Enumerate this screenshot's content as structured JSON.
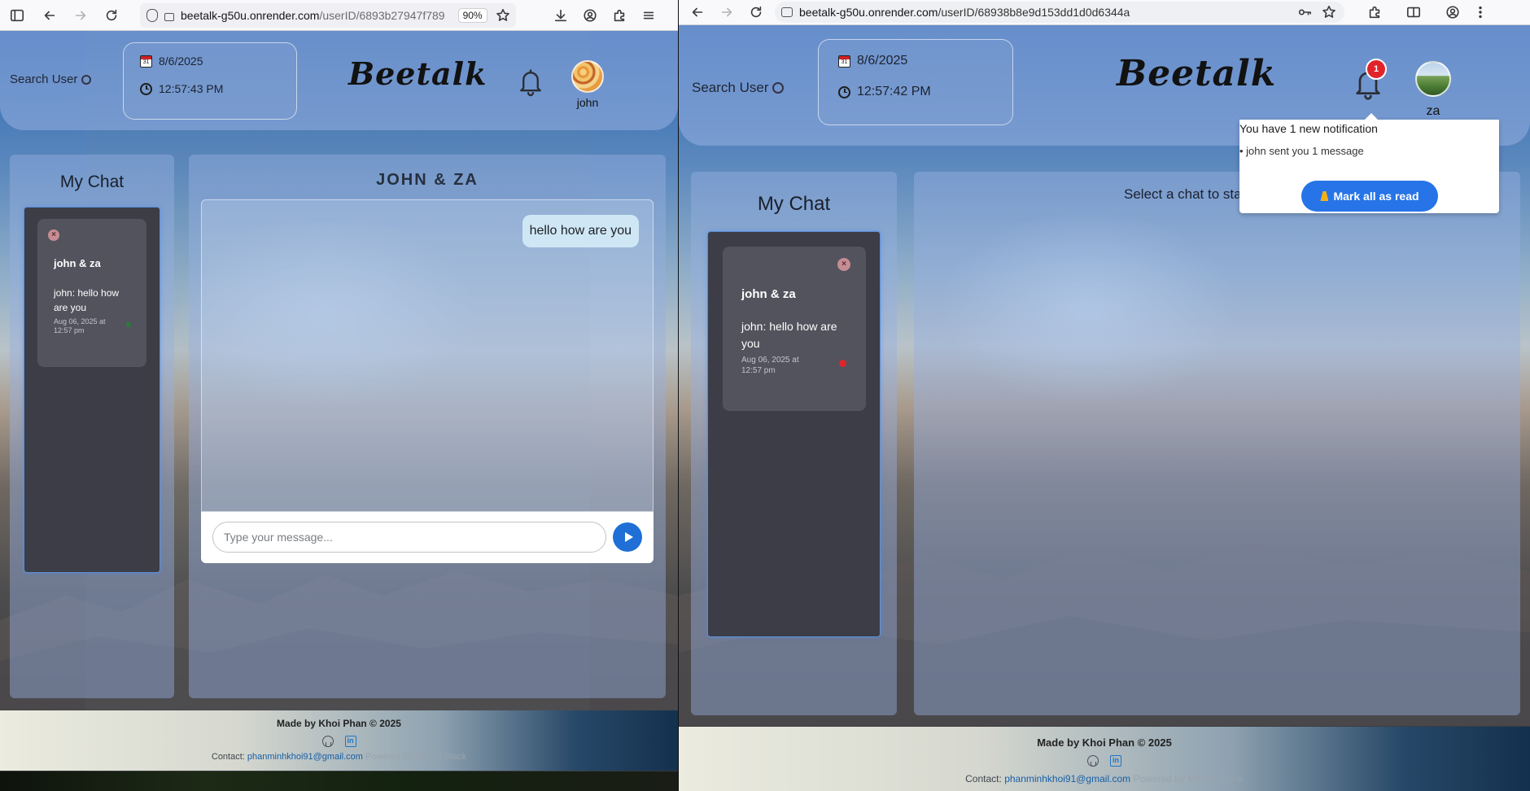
{
  "left": {
    "browser": {
      "url_host": "beetalk-g50u.onrender.com",
      "url_path": "/userID/6893b27947f789",
      "zoom": "90%"
    },
    "header": {
      "search_label": "Search User",
      "date": "8/6/2025",
      "time": "12:57:43 PM",
      "logo": "Beetalk",
      "username": "john"
    },
    "sidebar": {
      "title": "My Chat",
      "chats": [
        {
          "title": "john & za",
          "last_message": "john: hello how are you",
          "time": "Aug 06, 2025 at 12:57 pm"
        }
      ]
    },
    "chat": {
      "title": "JOHN & ZA",
      "messages": [
        {
          "text": "hello how are you",
          "own": true
        }
      ],
      "input_placeholder": "Type your message..."
    },
    "footer": {
      "made_by": "Made by Khoi Phan © 2025",
      "contact_label": "Contact:",
      "email": "phanminhkhoi91@gmail.com",
      "powered": "Powered by MERN Stack"
    }
  },
  "right": {
    "browser": {
      "url_host": "beetalk-g50u.onrender.com",
      "url_path": "/userID/68938b8e9d153dd1d0d6344a"
    },
    "header": {
      "search_label": "Search User",
      "date": "8/6/2025",
      "time": "12:57:42 PM",
      "logo": "Beetalk",
      "username": "za",
      "badge_count": "1"
    },
    "sidebar": {
      "title": "My Chat",
      "chats": [
        {
          "title": "john & za",
          "last_message": "john: hello how are you",
          "time": "Aug 06, 2025 at 12:57 pm"
        }
      ]
    },
    "chat": {
      "placeholder_text": "Select a chat to star"
    },
    "notifications": {
      "heading": "You have 1 new notification",
      "items": [
        "• john sent you 1 message"
      ],
      "mark_all": "Mark all as read"
    },
    "footer": {
      "made_by": "Made by Khoi Phan © 2025",
      "contact_label": "Contact:",
      "email": "phanminhkhoi91@gmail.com",
      "powered": "Powered by MERN Stack"
    }
  },
  "colors": {
    "accent": "#2674e8",
    "badge": "#e0242b",
    "unread_dot": "#e0242b",
    "card": "#52535d",
    "list_bg": "#3c3d47"
  }
}
